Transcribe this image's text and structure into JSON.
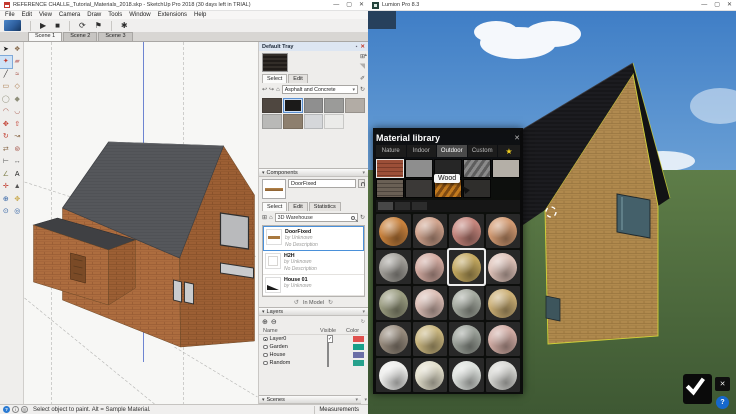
{
  "sketchup": {
    "title": "REFERENCE CHALLE_Tutorial_Materials_2018.skp - SketchUp Pro 2018 (30 days left in TRIAL)",
    "window_controls": [
      "—",
      "▢",
      "✕"
    ],
    "menu": [
      "File",
      "Edit",
      "View",
      "Camera",
      "Draw",
      "Tools",
      "Window",
      "Extensions",
      "Help"
    ],
    "toolbar": [
      {
        "name": "livesync-logo",
        "glyph": ""
      },
      {
        "name": "play-button",
        "glyph": "▶"
      },
      {
        "name": "stop-button",
        "glyph": "■"
      },
      {
        "name": "refresh-model-button",
        "glyph": "⟳"
      },
      {
        "name": "sync-camera-button",
        "glyph": "⚑"
      },
      {
        "name": "livesync-settings-button",
        "glyph": "✱"
      }
    ],
    "scene_tabs": [
      "Scene 1",
      "Scene 2",
      "Scene 3"
    ],
    "active_scene_index": 0,
    "selected_tool": "paint-bucket",
    "tools": [
      {
        "name": "select",
        "glyph": "➤",
        "color": "#1a1a1a"
      },
      {
        "name": "make-component",
        "glyph": "❖",
        "color": "#8a6d4f"
      },
      {
        "name": "paint-bucket",
        "glyph": "✦",
        "color": "#c0392b"
      },
      {
        "name": "eraser",
        "glyph": "▰",
        "color": "#c98f8f"
      },
      {
        "name": "line",
        "glyph": "╱",
        "color": "#333333"
      },
      {
        "name": "freehand",
        "glyph": "≈",
        "color": "#a34a3f"
      },
      {
        "name": "rectangle",
        "glyph": "▭",
        "color": "#a5713f"
      },
      {
        "name": "rotated-rectangle",
        "glyph": "◇",
        "color": "#a5713f"
      },
      {
        "name": "circle",
        "glyph": "◯",
        "color": "#8f8f7a"
      },
      {
        "name": "polygon",
        "glyph": "◆",
        "color": "#8f8f7a"
      },
      {
        "name": "arc",
        "glyph": "◠",
        "color": "#a5564a"
      },
      {
        "name": "two-point-arc",
        "glyph": "◡",
        "color": "#a5564a"
      },
      {
        "name": "move",
        "glyph": "✥",
        "color": "#c0392b"
      },
      {
        "name": "push-pull",
        "glyph": "⇧",
        "color": "#c0392b"
      },
      {
        "name": "rotate",
        "glyph": "↻",
        "color": "#c0392b"
      },
      {
        "name": "follow-me",
        "glyph": "↝",
        "color": "#8a6a4a"
      },
      {
        "name": "scale",
        "glyph": "⇄",
        "color": "#8a6a4a"
      },
      {
        "name": "offset",
        "glyph": "⊚",
        "color": "#a5564a"
      },
      {
        "name": "tape-measure",
        "glyph": "⊢",
        "color": "#555555"
      },
      {
        "name": "dimension",
        "glyph": "↔",
        "color": "#555555"
      },
      {
        "name": "protractor",
        "glyph": "∠",
        "color": "#8a8a5a"
      },
      {
        "name": "text",
        "glyph": "A",
        "color": "#222222"
      },
      {
        "name": "axes",
        "glyph": "✛",
        "color": "#c0392b"
      },
      {
        "name": "3d-text",
        "glyph": "▲",
        "color": "#555555"
      },
      {
        "name": "orbit",
        "glyph": "⊕",
        "color": "#2e5fa3"
      },
      {
        "name": "pan",
        "glyph": "✥",
        "color": "#c9a84a"
      },
      {
        "name": "zoom",
        "glyph": "⊙",
        "color": "#2e5fa3"
      },
      {
        "name": "zoom-extents",
        "glyph": "◎",
        "color": "#2e5fa3"
      }
    ],
    "tray": {
      "header": "Default Tray",
      "materials": {
        "tabs": [
          "Select",
          "Edit"
        ],
        "active_tab": "Select",
        "collection": "Asphalt and Concrete",
        "swatches": [
          [
            "#4f4740",
            "#1b1a19",
            "#8f8f8f",
            "#9b9b99",
            "#b2aca5"
          ],
          [
            "#b9b9b7",
            "#8d7f6e",
            "#d5d7da",
            "#ebebe9"
          ]
        ],
        "selected_swatch": [
          0,
          1
        ]
      },
      "components": {
        "header": "Components",
        "name_value": "DoorFixed",
        "tabs": [
          "Select",
          "Edit",
          "Statistics"
        ],
        "active_tab": "Select",
        "search_value": "3D Warehouse",
        "items": [
          {
            "name": "DoorFixed",
            "by": "by Unknown",
            "desc": "No Description"
          },
          {
            "name": "H2H",
            "by": "by Unknown",
            "desc": "No Description"
          },
          {
            "name": "House 01",
            "by": "by Unknown",
            "desc": ""
          }
        ],
        "selected_item": 0,
        "footer": "In Model"
      },
      "layers": {
        "header": "Layers",
        "columns": [
          "Name",
          "Visible",
          "Color"
        ],
        "rows": [
          {
            "name": "Layer0",
            "radio": true,
            "visible": true,
            "color": "#e0514e"
          },
          {
            "name": "Garden",
            "radio": false,
            "visible": false,
            "color": "#17a08a"
          },
          {
            "name": "House",
            "radio": false,
            "visible": false,
            "color": "#6b6ea6"
          },
          {
            "name": "Random",
            "radio": false,
            "visible": false,
            "color": "#26a18c"
          }
        ]
      },
      "scenes_header": "Scenes"
    },
    "status": {
      "hint": "Select object to paint. Alt = Sample Material.",
      "measurements_label": "Measurements"
    }
  },
  "lumion": {
    "title": "Lumion Pro 8.3",
    "window_controls": [
      "—",
      "▢",
      "✕"
    ],
    "material_library": {
      "title": "Material library",
      "close_glyph": "✕",
      "tabs": [
        "Nature",
        "Indoor",
        "Outdoor",
        "Custom"
      ],
      "active_tab": "Outdoor",
      "favorites_glyph": "★",
      "tooltip": "Wood",
      "categories": [
        {
          "name": "brick",
          "color": "#9c4f38",
          "color2": "#7a3a28",
          "pattern": "rows",
          "selected": true
        },
        {
          "name": "asphalt",
          "color": "#8e8e8e",
          "pattern": "flat"
        },
        {
          "name": "wood",
          "color": "#262626",
          "pattern": "flat"
        },
        {
          "name": "metal",
          "color": "#8a8a8a",
          "color2": "#5e5e5e",
          "pattern": "diag"
        },
        {
          "name": "plaster",
          "color": "#b4afa7",
          "pattern": "flat"
        },
        {
          "name": "roof-tiles",
          "color": "#6a6055",
          "color2": "#4c443c",
          "pattern": "rows"
        },
        {
          "name": "gravel",
          "color": "#3b3937",
          "pattern": "flat"
        },
        {
          "name": "rusted-metal",
          "color": "#c27a1e",
          "color2": "#7e4a12",
          "pattern": "diag"
        },
        {
          "name": "old-asphalt",
          "color": "#2f2e2c",
          "pattern": "flat"
        }
      ],
      "page_tabs": 3,
      "active_page": 0,
      "spheres": [
        [
          "#c9823d",
          "#cfa28c",
          "#c5857c",
          "#d29a72"
        ],
        [
          "#a3a09a",
          "#d2aaa0",
          "#c2a75e",
          "#dec2b8"
        ],
        [
          "#9a9c80",
          "#dabdb4",
          "#a5aaa0",
          "#cbaf75"
        ],
        [
          "#988c7e",
          "#c8b57e",
          "#9ca29a",
          "#d1aca4"
        ],
        [
          "#ededeb",
          "#e2decb",
          "#dde1dd",
          "#d8d8d4"
        ]
      ],
      "selected_sphere": [
        1,
        2
      ]
    },
    "help_label": "?"
  }
}
